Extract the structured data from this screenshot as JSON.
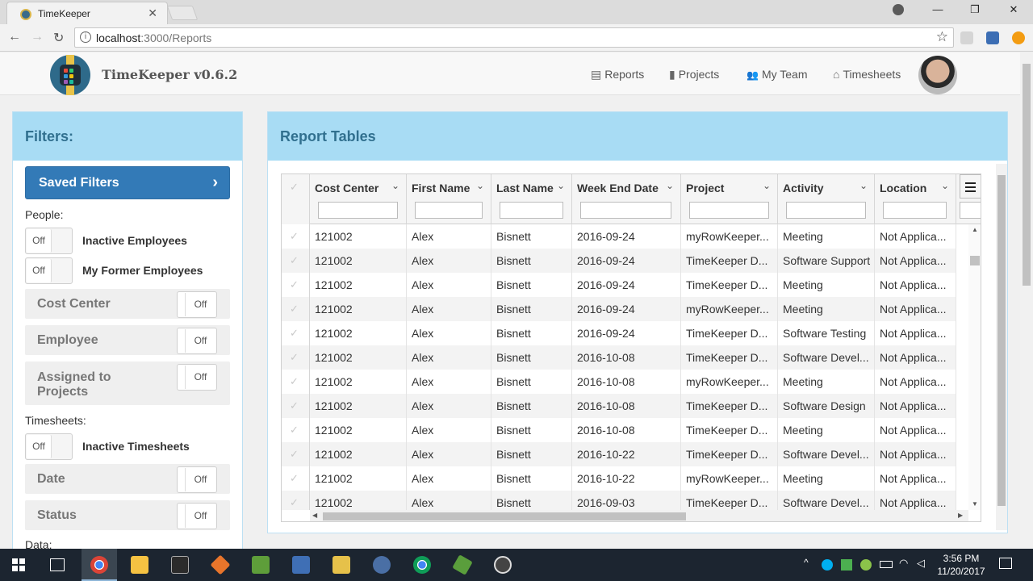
{
  "browser": {
    "tab_title": "TimeKeeper",
    "tab_close": "✕",
    "url_host": "localhost",
    "url_path": ":3000/Reports",
    "info_glyph": "i",
    "star_glyph": "☆",
    "nav_back": "←",
    "nav_forward": "→",
    "nav_reload": "↻",
    "win_minimize": "—",
    "win_restore": "❐",
    "win_close": "✕"
  },
  "app": {
    "brand": "TimeKeeper v0.6.2",
    "nav": [
      {
        "icon": "reports-icon",
        "glyph": "▤",
        "label": "Reports"
      },
      {
        "icon": "projects-icon",
        "glyph": "▮",
        "label": "Projects"
      },
      {
        "icon": "team-icon",
        "glyph": "👥",
        "label": "My Team"
      },
      {
        "icon": "home-icon",
        "glyph": "⌂",
        "label": "Timesheets"
      }
    ]
  },
  "filters": {
    "title": "Filters:",
    "saved_label": "Saved Filters",
    "chevron": "›",
    "people_label": "People:",
    "inactive_employees": "Inactive Employees",
    "former_employees": "My Former Employees",
    "cost_center": "Cost Center",
    "employee": "Employee",
    "assigned_line1": "Assigned to",
    "assigned_line2": "Projects",
    "timesheets_label": "Timesheets:",
    "inactive_timesheets": "Inactive Timesheets",
    "date": "Date",
    "status": "Status",
    "data_label": "Data:",
    "off": "Off"
  },
  "report": {
    "title": "Report Tables",
    "columns": [
      "Cost Center",
      "First Name",
      "Last Name",
      "Week End Date",
      "Project",
      "Activity",
      "Location"
    ],
    "caret": "⌄",
    "rows": [
      [
        "121002",
        "Alex",
        "Bisnett",
        "2016-09-24",
        "myRowKeeper...",
        "Meeting",
        "Not Applica..."
      ],
      [
        "121002",
        "Alex",
        "Bisnett",
        "2016-09-24",
        "TimeKeeper D...",
        "Software Support",
        "Not Applica..."
      ],
      [
        "121002",
        "Alex",
        "Bisnett",
        "2016-09-24",
        "TimeKeeper D...",
        "Meeting",
        "Not Applica..."
      ],
      [
        "121002",
        "Alex",
        "Bisnett",
        "2016-09-24",
        "myRowKeeper...",
        "Meeting",
        "Not Applica..."
      ],
      [
        "121002",
        "Alex",
        "Bisnett",
        "2016-09-24",
        "TimeKeeper D...",
        "Software Testing",
        "Not Applica..."
      ],
      [
        "121002",
        "Alex",
        "Bisnett",
        "2016-10-08",
        "TimeKeeper D...",
        "Software Devel...",
        "Not Applica..."
      ],
      [
        "121002",
        "Alex",
        "Bisnett",
        "2016-10-08",
        "myRowKeeper...",
        "Meeting",
        "Not Applica..."
      ],
      [
        "121002",
        "Alex",
        "Bisnett",
        "2016-10-08",
        "TimeKeeper D...",
        "Software Design",
        "Not Applica..."
      ],
      [
        "121002",
        "Alex",
        "Bisnett",
        "2016-10-08",
        "TimeKeeper D...",
        "Meeting",
        "Not Applica..."
      ],
      [
        "121002",
        "Alex",
        "Bisnett",
        "2016-10-22",
        "TimeKeeper D...",
        "Software Devel...",
        "Not Applica..."
      ],
      [
        "121002",
        "Alex",
        "Bisnett",
        "2016-10-22",
        "myRowKeeper...",
        "Meeting",
        "Not Applica..."
      ],
      [
        "121002",
        "Alex",
        "Bisnett",
        "2016-09-03",
        "TimeKeeper D...",
        "Software Devel...",
        "Not Applica..."
      ]
    ]
  },
  "taskbar": {
    "time": "3:56 PM",
    "date": "11/20/2017"
  },
  "colors": {
    "panel_header": "#a8dcf4",
    "panel_title": "#31708f",
    "primary_button": "#337ab7",
    "taskbar": "#1c2530"
  }
}
